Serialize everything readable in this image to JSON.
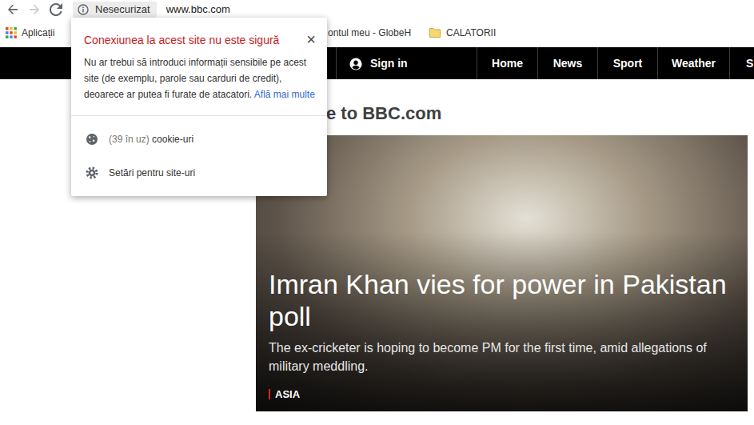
{
  "toolbar": {
    "buttons": [
      {
        "kind": "back",
        "disabled": false
      },
      {
        "kind": "forward",
        "disabled": true
      },
      {
        "kind": "reload",
        "disabled": false
      }
    ],
    "security": "Nesecurizat",
    "url": "www.bbc.com"
  },
  "bookmarks": [
    {
      "label": "Aplicații",
      "kind": "apps"
    },
    {
      "label": "ontul meu - GlobeH",
      "kind": "page"
    },
    {
      "label": "CALATORII",
      "kind": "folder"
    }
  ],
  "site_nav": {
    "sign_in": "Sign in",
    "items": [
      {
        "label": "Home"
      },
      {
        "label": "News"
      },
      {
        "label": "Sport"
      },
      {
        "label": "Weather"
      },
      {
        "label": "S"
      }
    ]
  },
  "page": {
    "heading": "e to BBC.com",
    "story": {
      "headline": "Imran Khan vies for power in Pakistan poll",
      "summary": "The ex-cricketer is hoping to become PM for the first time, amid allegations of military meddling.",
      "tag": "ASIA"
    }
  },
  "popup": {
    "title": "Conexiunea la acest site nu este sigură",
    "close": "×",
    "message": "Nu ar trebui să introduci informații sensibile pe acest site (de exemplu, parole sau carduri de credit), deoarece ar putea fi furate de atacatori.",
    "link": "Află mai multe",
    "items": [
      {
        "count": "(39 în uz)",
        "label": "cookie-uri",
        "kind": "cookie"
      },
      {
        "label": "Setări pentru site-uri",
        "kind": "settings"
      }
    ]
  }
}
